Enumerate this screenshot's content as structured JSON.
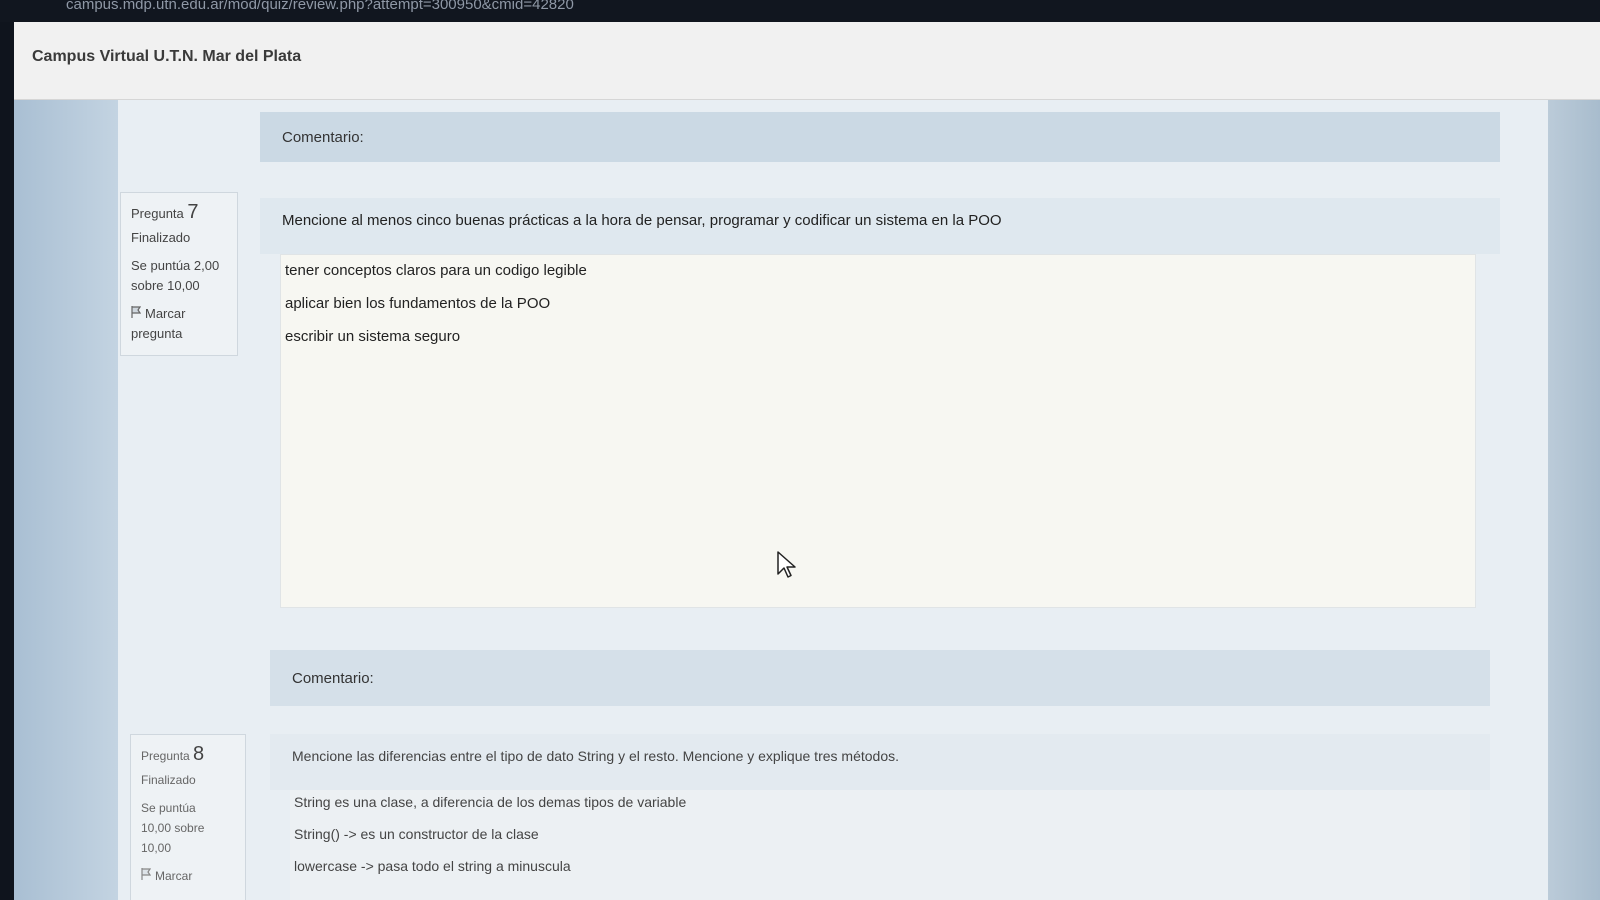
{
  "browser": {
    "url": "campus.mdp.utn.edu.ar/mod/quiz/review.php?attempt=300950&cmid=42820"
  },
  "header": {
    "site_name": "Campus Virtual U.T.N. Mar del Plata"
  },
  "top_comment": {
    "label": "Comentario:"
  },
  "question7": {
    "prefix": "Pregunta",
    "number": "7",
    "status": "Finalizado",
    "score_line1": "Se puntúa 2,00",
    "score_line2": "sobre 10,00",
    "flag_line1": "Marcar",
    "flag_line2": "pregunta",
    "text": "Mencione al menos cinco buenas prácticas a la hora de pensar, programar y codificar un sistema en la POO",
    "answer_lines": [
      "tener conceptos claros para un codigo legible",
      "aplicar bien los fundamentos de la POO",
      "escribir un sistema seguro"
    ],
    "comment_label": "Comentario:"
  },
  "question8": {
    "prefix": "Pregunta",
    "number": "8",
    "status": "Finalizado",
    "score_line1": "Se puntúa",
    "score_line2": "10,00 sobre",
    "score_line3": "10,00",
    "flag_line1": "Marcar",
    "text": "Mencione las diferencias entre el tipo de dato String y el resto. Mencione y explique tres métodos.",
    "answer_lines": [
      "String es una clase, a diferencia de los demas tipos de variable",
      "String() -> es un constructor de la clase",
      "lowercase -> pasa todo el string a minuscula"
    ]
  }
}
